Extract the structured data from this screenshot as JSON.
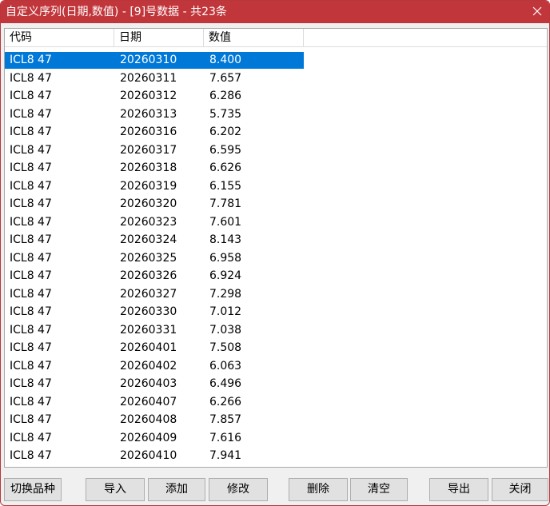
{
  "window": {
    "title": "自定义序列(日期,数值) - [9]号数据 - 共23条"
  },
  "table": {
    "columns": [
      "代码",
      "日期",
      "数值"
    ],
    "selected_index": 0,
    "rows": [
      [
        "ICL8 47",
        "20260310",
        "8.400"
      ],
      [
        "ICL8 47",
        "20260311",
        "7.657"
      ],
      [
        "ICL8 47",
        "20260312",
        "6.286"
      ],
      [
        "ICL8 47",
        "20260313",
        "5.735"
      ],
      [
        "ICL8 47",
        "20260316",
        "6.202"
      ],
      [
        "ICL8 47",
        "20260317",
        "6.595"
      ],
      [
        "ICL8 47",
        "20260318",
        "6.626"
      ],
      [
        "ICL8 47",
        "20260319",
        "6.155"
      ],
      [
        "ICL8 47",
        "20260320",
        "7.781"
      ],
      [
        "ICL8 47",
        "20260323",
        "7.601"
      ],
      [
        "ICL8 47",
        "20260324",
        "8.143"
      ],
      [
        "ICL8 47",
        "20260325",
        "6.958"
      ],
      [
        "ICL8 47",
        "20260326",
        "6.924"
      ],
      [
        "ICL8 47",
        "20260327",
        "7.298"
      ],
      [
        "ICL8 47",
        "20260330",
        "7.012"
      ],
      [
        "ICL8 47",
        "20260331",
        "7.038"
      ],
      [
        "ICL8 47",
        "20260401",
        "7.508"
      ],
      [
        "ICL8 47",
        "20260402",
        "6.063"
      ],
      [
        "ICL8 47",
        "20260403",
        "6.496"
      ],
      [
        "ICL8 47",
        "20260407",
        "6.266"
      ],
      [
        "ICL8 47",
        "20260408",
        "7.857"
      ],
      [
        "ICL8 47",
        "20260409",
        "7.616"
      ],
      [
        "ICL8 47",
        "20260410",
        "7.941"
      ]
    ]
  },
  "buttons": {
    "switch_variety": "切换品种",
    "import": "导入",
    "add": "添加",
    "modify": "修改",
    "delete": "删除",
    "clear": "清空",
    "export": "导出",
    "close": "关闭"
  },
  "icons": {
    "close": "close-icon"
  },
  "colors": {
    "titlebar": "#c1363b",
    "selection": "#0078d7",
    "button_face": "#e1e1e1"
  }
}
